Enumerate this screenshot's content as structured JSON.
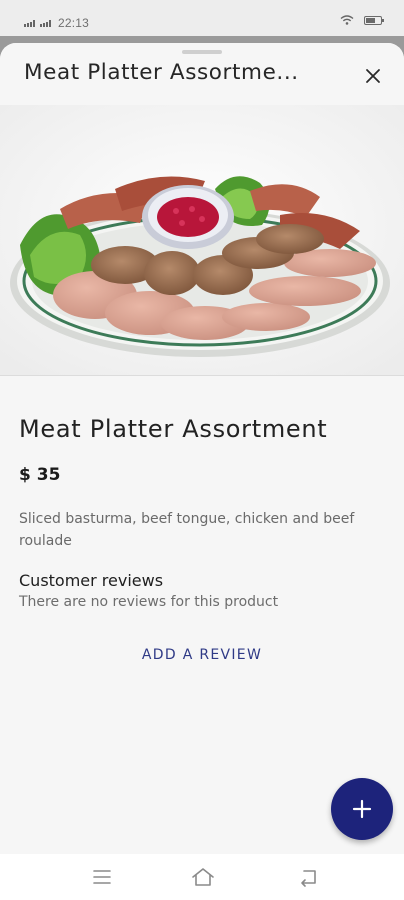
{
  "status_bar": {
    "time": "22:13",
    "battery_level": 0.7,
    "icons": [
      "signal-icon",
      "signal-icon",
      "wifi-icon",
      "battery-icon"
    ]
  },
  "sheet": {
    "title": "Meat Platter Assortme...",
    "close_icon": "close-icon"
  },
  "product": {
    "image_alt": "meat-platter-photo",
    "name": "Meat Platter Assortment",
    "price": "$ 35",
    "description": "Sliced basturma, beef tongue, chicken and beef roulade"
  },
  "reviews": {
    "heading": "Customer reviews",
    "empty_text": "There are no reviews for this product",
    "add_label": "ADD A REVIEW"
  },
  "fab": {
    "icon": "plus-icon",
    "color": "#1d237b"
  },
  "nav_bar": {
    "icons": [
      "menu-icon",
      "home-icon",
      "back-icon"
    ]
  },
  "colors": {
    "accent": "#1d237b",
    "link": "#2f3a86",
    "sheet_background": "#f6f6f6"
  }
}
